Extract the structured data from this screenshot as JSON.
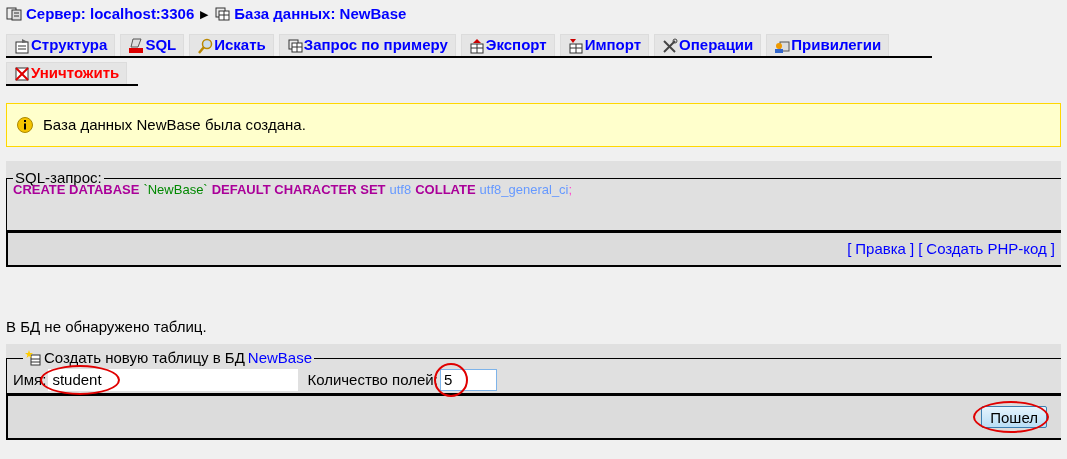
{
  "breadcrumb": [
    {
      "label": "Сервер: localhost:3306",
      "kind": "server"
    },
    {
      "separator": "▶",
      "label": "База данных: NewBase",
      "kind": "database"
    }
  ],
  "tabs": [
    {
      "label": "Структура",
      "kind": "structure",
      "danger": false
    },
    {
      "label": "SQL",
      "kind": "sql",
      "danger": false
    },
    {
      "label": "Искать",
      "kind": "search",
      "danger": false
    },
    {
      "label": "Запрос по примеру",
      "kind": "query",
      "danger": false
    },
    {
      "label": "Экспорт",
      "kind": "export",
      "danger": false
    },
    {
      "label": "Импорт",
      "kind": "import",
      "danger": false
    },
    {
      "label": "Операции",
      "kind": "operations",
      "danger": false
    },
    {
      "label": "Привилегии",
      "kind": "privileges",
      "danger": false
    },
    {
      "label": "Уничтожить",
      "kind": "drop",
      "danger": true
    }
  ],
  "notice": "База данных NewBase была создана.",
  "sql_panel": {
    "legend": "SQL-запрос:",
    "tokens": [
      {
        "text": "CREATE DATABASE",
        "kind": "keyword"
      },
      {
        "text": "`NewBase`",
        "kind": "identifier"
      },
      {
        "text": "DEFAULT CHARACTER SET",
        "kind": "keyword"
      },
      {
        "text": "utf8",
        "kind": "value"
      },
      {
        "text": "COLLATE",
        "kind": "keyword"
      },
      {
        "text": "utf8_general_ci",
        "kind": "value"
      },
      {
        "text": ";",
        "kind": "punct"
      }
    ],
    "links": [
      {
        "open": "[",
        "label": "Правка",
        "close": "]"
      },
      {
        "open": "[",
        "label": "Создать PHP-код",
        "close": "]"
      }
    ]
  },
  "empty_message": "В БД не обнаружено таблиц.",
  "create_table": {
    "legend": "Создать новую таблицу в БД",
    "database": "NewBase",
    "name_label": "Имя:",
    "name_value": "student",
    "name_highlighted": true,
    "fields_label": "Количество полей:",
    "fields_value": "5",
    "fields_highlighted": true,
    "button": "Пошел",
    "button_highlighted": true
  }
}
